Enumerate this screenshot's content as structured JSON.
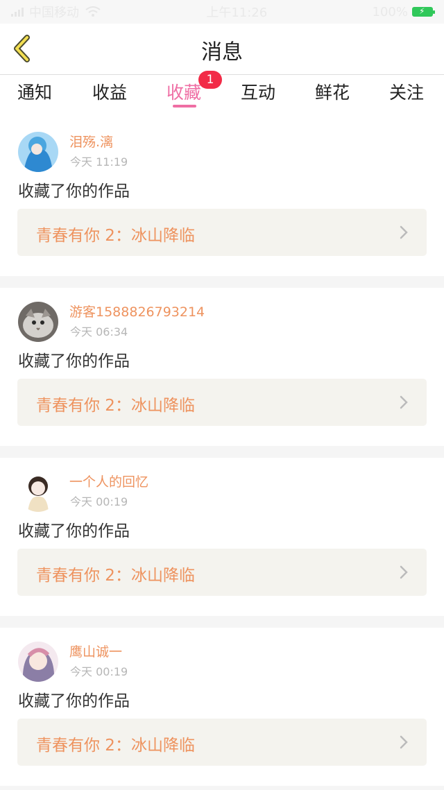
{
  "status_bar": {
    "carrier": "中国移动",
    "time": "上午11:26",
    "battery": "100%"
  },
  "nav": {
    "title": "消息"
  },
  "tabs": [
    {
      "label": "通知"
    },
    {
      "label": "收益"
    },
    {
      "label": "收藏",
      "badge": "1",
      "active": true
    },
    {
      "label": "互动"
    },
    {
      "label": "鲜花"
    },
    {
      "label": "关注"
    }
  ],
  "messages": [
    {
      "user": "泪殇.漓",
      "time": "今天 11:19",
      "action": "收藏了你的作品",
      "work": "青春有你 2：冰山降临"
    },
    {
      "user": "游客1588826793214",
      "time": "今天 06:34",
      "action": "收藏了你的作品",
      "work": "青春有你 2：冰山降临"
    },
    {
      "user": "一个人的回忆",
      "time": "今天 00:19",
      "action": "收藏了你的作品",
      "work": "青春有你 2：冰山降临"
    },
    {
      "user": "鹰山诚一",
      "time": "今天 00:19",
      "action": "收藏了你的作品",
      "work": "青春有你 2：冰山降临"
    }
  ]
}
